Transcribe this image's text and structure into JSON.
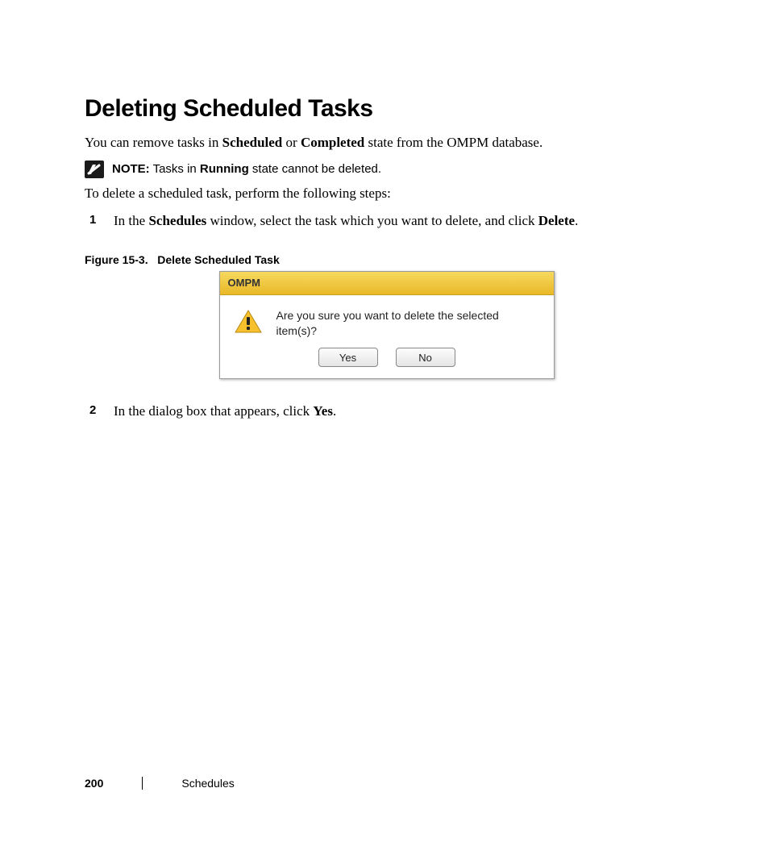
{
  "heading": "Deleting Scheduled Tasks",
  "intro": {
    "pre": "You can remove tasks in ",
    "b1": "Scheduled",
    "mid": " or ",
    "b2": "Completed",
    "post": " state from the OMPM database."
  },
  "note": {
    "label": "NOTE:",
    "p1": " Tasks in ",
    "b": "Running",
    "p2": " state cannot be deleted."
  },
  "lead": "To delete a scheduled task, perform the following steps:",
  "steps": {
    "s1": {
      "num": "1",
      "t1": "In the ",
      "b1": "Schedules",
      "t2": " window, select the task which you want to delete, and click ",
      "b2": "Delete",
      "t3": "."
    },
    "s2": {
      "num": "2",
      "t1": "In the dialog box that appears, click ",
      "b1": "Yes",
      "t2": "."
    }
  },
  "figure": {
    "caption_a": "Figure 15-3.",
    "caption_b": "Delete Scheduled Task"
  },
  "dialog": {
    "title": "OMPM",
    "message": "Are you sure you want to delete the selected item(s)?",
    "yes": "Yes",
    "no": "No"
  },
  "footer": {
    "page": "200",
    "section": "Schedules"
  }
}
